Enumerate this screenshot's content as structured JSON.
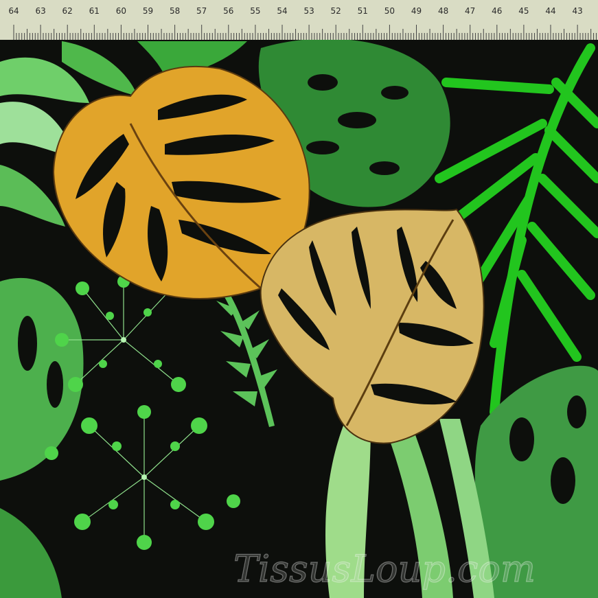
{
  "ruler": {
    "ticks": [
      "64",
      "63",
      "62",
      "61",
      "60",
      "59",
      "58",
      "57",
      "56",
      "55",
      "54",
      "53",
      "52",
      "51",
      "50",
      "49",
      "48",
      "47",
      "46",
      "45",
      "44",
      "43"
    ]
  },
  "watermark": {
    "text": "TissusLoup.com"
  },
  "colors": {
    "background": "#0d0f0c",
    "ruler": "#d9dcc4",
    "leaf_orange": "#e1a42a",
    "leaf_gold": "#d7b765",
    "leaf_green_bright": "#22c51e",
    "leaf_green_light": "#7bd17a",
    "leaf_green_dark": "#2f8a34"
  },
  "icons": [
    "ruler",
    "monstera-leaf",
    "palm-frond",
    "umbel-flower",
    "fern"
  ]
}
